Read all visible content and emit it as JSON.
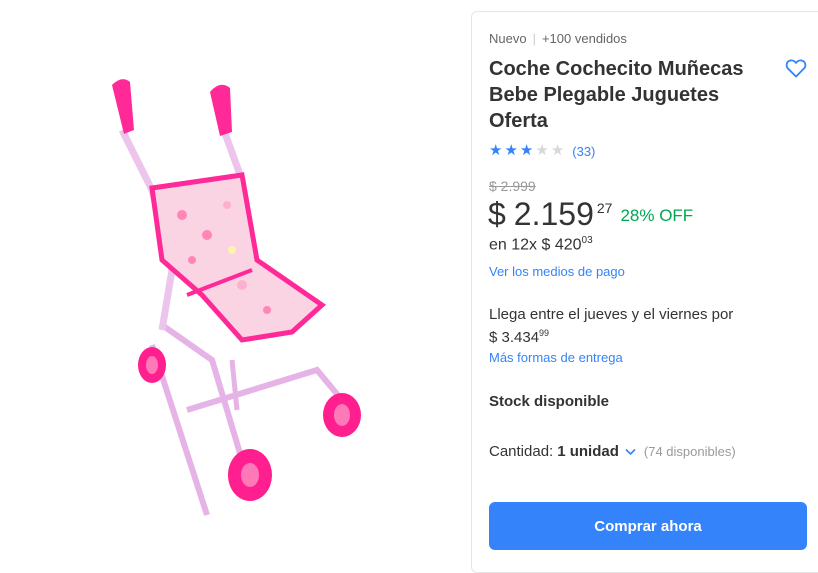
{
  "product": {
    "condition": "Nuevo",
    "sold": "+100 vendidos",
    "title": "Coche Cochecito Muñecas Bebe Plegable Juguetes Oferta",
    "rating_value": 3,
    "rating_count": "(33)",
    "stars": [
      "★",
      "★",
      "★",
      "★",
      "★"
    ],
    "image_icon": "doll-stroller-image",
    "favorite_icon": "heart-icon"
  },
  "price": {
    "old": "$ 2.999",
    "currency": "$",
    "integer": "2.159",
    "cents": "27",
    "discount": "28% OFF",
    "installments_prefix": "en 12x $ 420",
    "installments_cents": "03",
    "payment_link": "Ver los medios de pago"
  },
  "shipping": {
    "text": "Llega entre el jueves y el viernes por",
    "price": "$ 3.434",
    "price_cents": "99",
    "link": "Más formas de entrega"
  },
  "stock": {
    "label": "Stock disponible"
  },
  "quantity": {
    "label": "Cantidad:",
    "value": "1 unidad",
    "available": "(74 disponibles)"
  },
  "buy_button": "Comprar ahora",
  "colors": {
    "accent": "#3483fa",
    "discount": "#00a650",
    "stroller_pink": "#ff1f8e",
    "frame": "#e8b6e6"
  }
}
